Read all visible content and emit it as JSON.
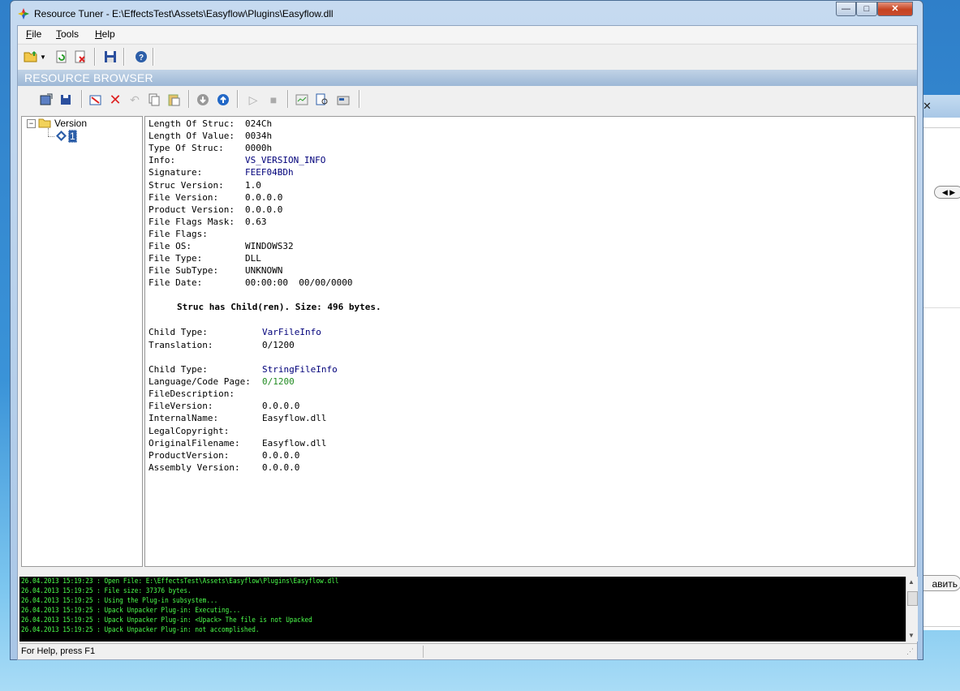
{
  "window": {
    "title": "Resource Tuner - E:\\EffectsTest\\Assets\\Easyflow\\Plugins\\Easyflow.dll",
    "min_glyph": "—",
    "max_glyph": "□",
    "close_glyph": "✕"
  },
  "menu": {
    "file": "File",
    "tools": "Tools",
    "help": "Help"
  },
  "panel_title": "RESOURCE BROWSER",
  "tree": {
    "root_label": "Version",
    "child_label": "1"
  },
  "version_info": [
    {
      "label": "Length Of Struc:",
      "value": "024Ch",
      "color": "black"
    },
    {
      "label": "Length Of Value:",
      "value": "0034h",
      "color": "black"
    },
    {
      "label": "Type Of Struc:",
      "value": "0000h",
      "color": "black"
    },
    {
      "label": "Info:",
      "value": "VS_VERSION_INFO",
      "color": "blue"
    },
    {
      "label": "Signature:",
      "value": "FEEF04BDh",
      "color": "blue"
    },
    {
      "label": "Struc Version:",
      "value": "1.0",
      "color": "black"
    },
    {
      "label": "File Version:",
      "value": "0.0.0.0",
      "color": "black"
    },
    {
      "label": "Product Version:",
      "value": "0.0.0.0",
      "color": "black"
    },
    {
      "label": "File Flags Mask:",
      "value": "0.63",
      "color": "black"
    },
    {
      "label": "File Flags:",
      "value": "",
      "color": "black"
    },
    {
      "label": "File OS:",
      "value": "WINDOWS32",
      "color": "black"
    },
    {
      "label": "File Type:",
      "value": "DLL",
      "color": "black"
    },
    {
      "label": "File SubType:",
      "value": "UNKNOWN",
      "color": "black"
    },
    {
      "label": "File Date:",
      "value": "00:00:00  00/00/0000",
      "color": "black"
    }
  ],
  "child_note": "Struc has Child(ren). Size: 496 bytes.",
  "var_file_info": [
    {
      "label": "Child Type:",
      "value": "VarFileInfo",
      "color": "blue"
    },
    {
      "label": "Translation:",
      "value": "0/1200",
      "color": "black"
    }
  ],
  "string_file_info": [
    {
      "label": "Child Type:",
      "value": "StringFileInfo",
      "color": "blue"
    },
    {
      "label": "Language/Code Page:",
      "value": "0/1200",
      "color": "green"
    },
    {
      "label": "FileDescription:",
      "value": "",
      "color": "black"
    },
    {
      "label": "FileVersion:",
      "value": "0.0.0.0",
      "color": "black"
    },
    {
      "label": "InternalName:",
      "value": "Easyflow.dll",
      "color": "black"
    },
    {
      "label": "LegalCopyright:",
      "value": "",
      "color": "black"
    },
    {
      "label": "OriginalFilename:",
      "value": "Easyflow.dll",
      "color": "black"
    },
    {
      "label": "ProductVersion:",
      "value": "0.0.0.0",
      "color": "black"
    },
    {
      "label": "Assembly Version:",
      "value": "0.0.0.0",
      "color": "black"
    }
  ],
  "log": [
    "26.04.2013 15:19:23 : Open File: E:\\EffectsTest\\Assets\\Easyflow\\Plugins\\Easyflow.dll",
    "26.04.2013 15:19:25 : File size: 37376 bytes.",
    "26.04.2013 15:19:25 : Using the Plug-in subsystem...",
    "26.04.2013 15:19:25 : Upack Unpacker Plug-in: Executing...",
    "26.04.2013 15:19:25 : Upack Unpacker Plug-in: <Upack> The file is not Upacked",
    "26.04.2013 15:19:25 : Upack Unpacker Plug-in: not accomplished."
  ],
  "status": "For Help, press F1",
  "background_window": {
    "button_fragment": "авить"
  }
}
